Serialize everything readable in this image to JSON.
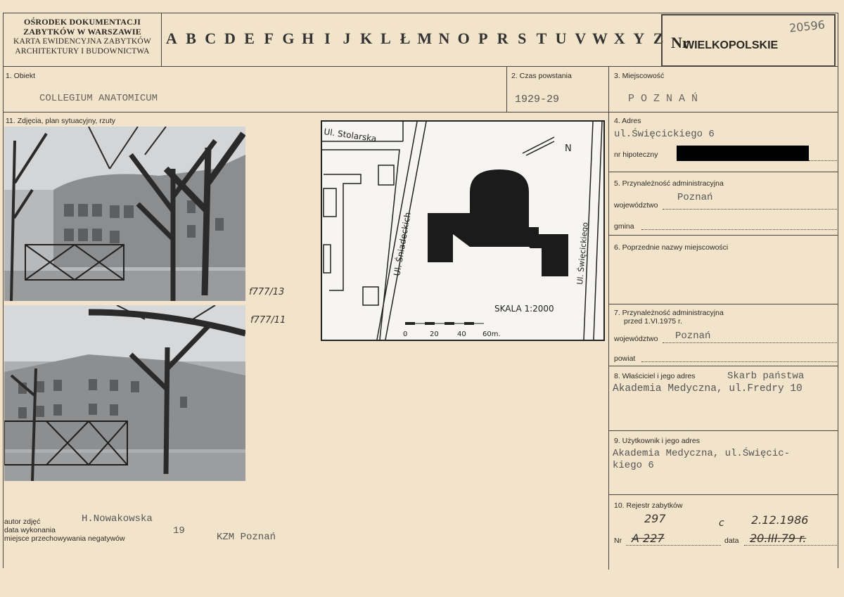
{
  "header": {
    "institution_line1": "OŚRODEK DOKUMENTACJI",
    "institution_line2": "ZABYTKÓW W WARSZAWIE",
    "card_type_line1": "KARTA EWIDENCYJNA ZABYTKÓW",
    "card_type_line2": "ARCHITEKTURY I BUDOWNICTWA",
    "letters": [
      "A",
      "B",
      "C",
      "D",
      "E",
      "F",
      "G",
      "H",
      "I",
      "J",
      "K",
      "L",
      "Ł",
      "M",
      "N",
      "O",
      "P",
      "R",
      "S",
      "T",
      "U",
      "V",
      "W",
      "X",
      "Y",
      "Z"
    ],
    "nr_label": "Nr",
    "region": "WIELKOPOLSKIE",
    "inventory_number": "20596"
  },
  "fields": {
    "f1_label": "1. Obiekt",
    "f1_value": "COLLEGIUM ANATOMICUM",
    "f2_label": "2. Czas powstania",
    "f2_value": "1929-29",
    "f3_label": "3. Miejscowość",
    "f3_value": "P O Z N A Ń",
    "f4_label": "4. Adres",
    "f4_value": "ul.Święcickiego 6",
    "f4_mortgage_label": "nr hipoteczny",
    "f5_label": "5. Przynależność administracyjna",
    "f5_voiv_label": "województwo",
    "f5_voiv_value": "Poznań",
    "f5_gmina_label": "gmina",
    "f6_label": "6. Poprzednie nazwy miejscowości",
    "f7_label_line1": "7. Przynależność administracyjna",
    "f7_label_line2": "przed 1.VI.1975 r.",
    "f7_voiv_label": "województwo",
    "f7_voiv_value": "Poznań",
    "f7_powiat_label": "powiat",
    "f8_label": "8. Właściciel i jego adres",
    "f8_value_line1": "Skarb państwa",
    "f8_value_line2": "Akademia Medyczna, ul.Fredry 10",
    "f9_label": "9. Użytkownik i jego adres",
    "f9_value_line1": "Akademia Medyczna, ul.Święcic-",
    "f9_value_line2": "kiego 6",
    "f10_label": "10. Rejestr zabytków",
    "f10_nr_label": "Nr",
    "f10_data_label": "data",
    "f10_nr_new": "297",
    "f10_nr_old": "A 227",
    "f10_data_new": "2.12.1986",
    "f10_data_old": "20.III.79 r.",
    "f10_marker": "c",
    "f11_label": "11. Zdjęcia, plan sytuacyjny, rzuty"
  },
  "photos": {
    "photo1_ref": "f777/13",
    "photo2_ref": "f777/11"
  },
  "map": {
    "street_top": "Ul. Stolarska",
    "street_left": "Ul. Śniadeckich",
    "street_right": "Ul. Święcickiego",
    "north": "N",
    "scale": "SKALA 1:2000",
    "scale_ticks": [
      "0",
      "20",
      "40",
      "60m."
    ]
  },
  "footer": {
    "author_label": "autor zdjęć",
    "author_value": "H.Nowakowska",
    "date_label": "data wykonania",
    "date_value": "19",
    "storage_label": "miejsce przechowywania negatywów",
    "storage_value": "KZM Poznań"
  }
}
